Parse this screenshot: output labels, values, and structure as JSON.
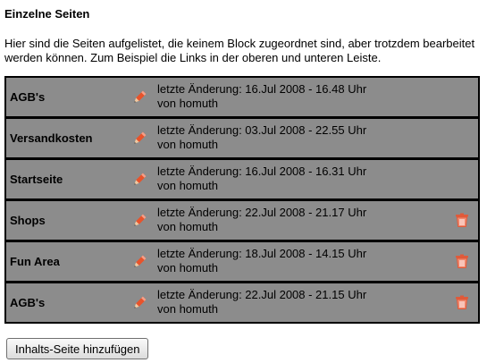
{
  "section": {
    "title": "Einzelne Seiten",
    "description": "Hier sind die Seiten aufgelistet, die keinem Block zugeordnet sind, aber trotzdem bearbeitet werden können. Zum Beispiel die Links in der oberen und unteren Leiste."
  },
  "pages": [
    {
      "name": "AGB's",
      "modified": "letzte Änderung: 16.Jul 2008 - 16.48 Uhr",
      "author": "von homuth",
      "deletable": false
    },
    {
      "name": "Versandkosten",
      "modified": "letzte Änderung: 03.Jul 2008 - 22.55 Uhr",
      "author": "von homuth",
      "deletable": false
    },
    {
      "name": "Startseite",
      "modified": "letzte Änderung: 16.Jul 2008 - 16.31 Uhr",
      "author": "von homuth",
      "deletable": false
    },
    {
      "name": "Shops",
      "modified": "letzte Änderung: 22.Jul 2008 - 21.17 Uhr",
      "author": "von homuth",
      "deletable": true
    },
    {
      "name": "Fun Area",
      "modified": "letzte Änderung: 18.Jul 2008 - 14.15 Uhr",
      "author": "von homuth",
      "deletable": true
    },
    {
      "name": "AGB's",
      "modified": "letzte Änderung: 22.Jul 2008 - 21.15 Uhr",
      "author": "von homuth",
      "deletable": true
    }
  ],
  "icons": {
    "edit": "pencil-icon",
    "delete": "trash-icon"
  },
  "colors": {
    "row_background": "#8c8c8c",
    "row_border": "#000000",
    "edit_icon": "#e8532b",
    "delete_icon": "#e05a3a"
  },
  "actions": {
    "add_page_label": "Inhalts-Seite hinzufügen"
  }
}
